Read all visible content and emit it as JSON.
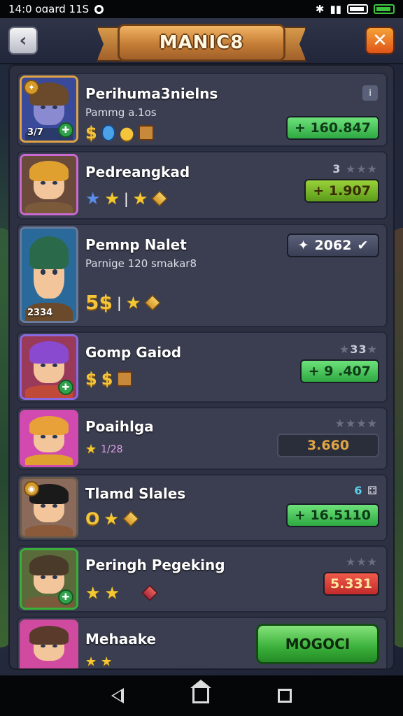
{
  "status_bar": {
    "time_text": "14:0 oɑard 11S",
    "icons": [
      "bluetooth-icon",
      "signal-icon",
      "battery-icon",
      "battery-charging-icon"
    ]
  },
  "header": {
    "title": "MANIC8",
    "back_icon": "chevron-left-icon",
    "close_icon": "close-x-icon",
    "close_color": "#e85a1a"
  },
  "rows": [
    {
      "name": "Perihuma3nielns",
      "sub": "Pammg a.1os",
      "level": "3/7",
      "value": "+ 160.847",
      "value_color": "green",
      "right_icon": "info-icon",
      "hair": "#6a4a2a",
      "bg": "#3a4a9a"
    },
    {
      "name": "Pedreangkad",
      "rating": "3",
      "value": "+ 1.907",
      "value_color": "olive",
      "hair": "#e0a030",
      "bg": "#6a4a3a"
    },
    {
      "name": "Pemnp Nalet",
      "sub": "Parnige 120 smakar8",
      "level": "2334",
      "amount": "5$",
      "value": "2062",
      "value_color": "grey",
      "hair": "#2a6a4a",
      "bg": "#2a6a9a"
    },
    {
      "name": "Gomp Gaiod",
      "rating": "33",
      "value": "+ 9 .407",
      "value_color": "green",
      "hair": "#8a4ad0",
      "bg": "#9a3a5a"
    },
    {
      "name": "Poaihlga",
      "extra": "1/28",
      "value": "3.660",
      "value_color": "dark",
      "hair": "#e8a038",
      "bg": "#d04ab0"
    },
    {
      "name": "Tlamd Slales",
      "rating": "6",
      "value": "+ 16.5110",
      "value_color": "green",
      "hair": "#1a1a1a",
      "bg": "#8a6a5a"
    },
    {
      "name": "Peringh Pegeking",
      "value": "5.331",
      "value_color": "red",
      "hair": "#4a3a2a",
      "bg": "#5a6a3a"
    },
    {
      "name": "Mehaake",
      "button": "MOGOCI",
      "hair": "#5a3a2a",
      "bg": "#d04aa0"
    }
  ],
  "nav": {
    "back": "nav-back-icon",
    "home": "nav-home-icon",
    "recents": "nav-recents-icon"
  }
}
